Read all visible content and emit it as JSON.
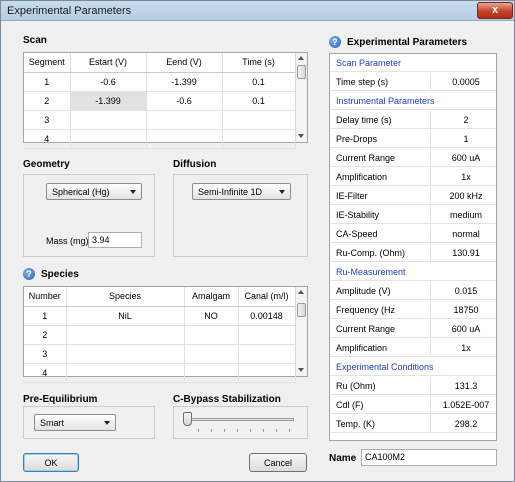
{
  "window": {
    "title": "Experimental Parameters",
    "close_glyph": "x"
  },
  "scan": {
    "label": "Scan",
    "columns": [
      "Segment",
      "Estart (V)",
      "Eend (V)",
      "Time (s)"
    ],
    "rows": [
      [
        "1",
        "-0.6",
        "-1.399",
        "0.1"
      ],
      [
        "2",
        "-1.399",
        "-0.6",
        "0.1"
      ],
      [
        "3",
        "",
        "",
        ""
      ],
      [
        "4",
        "",
        "",
        ""
      ]
    ]
  },
  "geometry": {
    "label": "Geometry",
    "selected": "Spherical (Hg)",
    "mass_label": "Mass (mg)",
    "mass_value": "3.94"
  },
  "diffusion": {
    "label": "Diffusion",
    "selected": "Semi-Infinite 1D"
  },
  "species": {
    "label": "Species",
    "columns": [
      "Number",
      "Species",
      "Amalgam",
      "Canal (m/l)"
    ],
    "rows": [
      [
        "1",
        "NiL",
        "NO",
        "0.00148"
      ],
      [
        "2",
        "",
        "",
        ""
      ],
      [
        "3",
        "",
        "",
        ""
      ],
      [
        "4",
        "",
        "",
        ""
      ]
    ]
  },
  "pre_equilibrium": {
    "label": "Pre-Equilibrium",
    "selected": "Smart"
  },
  "cbypass": {
    "label": "C-Bypass Stabilization",
    "level": 0
  },
  "buttons": {
    "ok": "OK",
    "cancel": "Cancel"
  },
  "experimental": {
    "label": "Experimental Parameters",
    "rows": [
      {
        "key": "Scan Parameter",
        "value": "",
        "header": true
      },
      {
        "key": "Time step (s)",
        "value": "0.0005"
      },
      {
        "key": "Instrumental Parameters",
        "value": "",
        "header": true
      },
      {
        "key": "Delay time (s)",
        "value": "2"
      },
      {
        "key": "Pre-Drops",
        "value": "1"
      },
      {
        "key": "Current Range",
        "value": "600 uA"
      },
      {
        "key": "Amplification",
        "value": "1x"
      },
      {
        "key": "IE-Filter",
        "value": "200 kHz"
      },
      {
        "key": "IE-Stability",
        "value": "medium"
      },
      {
        "key": "CA-Speed",
        "value": "normal"
      },
      {
        "key": "Ru-Comp. (Ohm)",
        "value": "130.91"
      },
      {
        "key": "Ru-Measurement",
        "value": "",
        "header": true
      },
      {
        "key": "Amplitude (V)",
        "value": "0.015"
      },
      {
        "key": "Frequency (Hz",
        "value": "18750"
      },
      {
        "key": "Current Range",
        "value": "600 uA"
      },
      {
        "key": "Amplification",
        "value": "1x"
      },
      {
        "key": "Experimental Conditions",
        "value": "",
        "header": true
      },
      {
        "key": "Ru (Ohm)",
        "value": "131.3"
      },
      {
        "key": "Cdl (F)",
        "value": "1.052E-007"
      },
      {
        "key": "Temp. (K)",
        "value": "298.2"
      }
    ]
  },
  "name": {
    "label": "Name",
    "value": "CA100M2"
  }
}
